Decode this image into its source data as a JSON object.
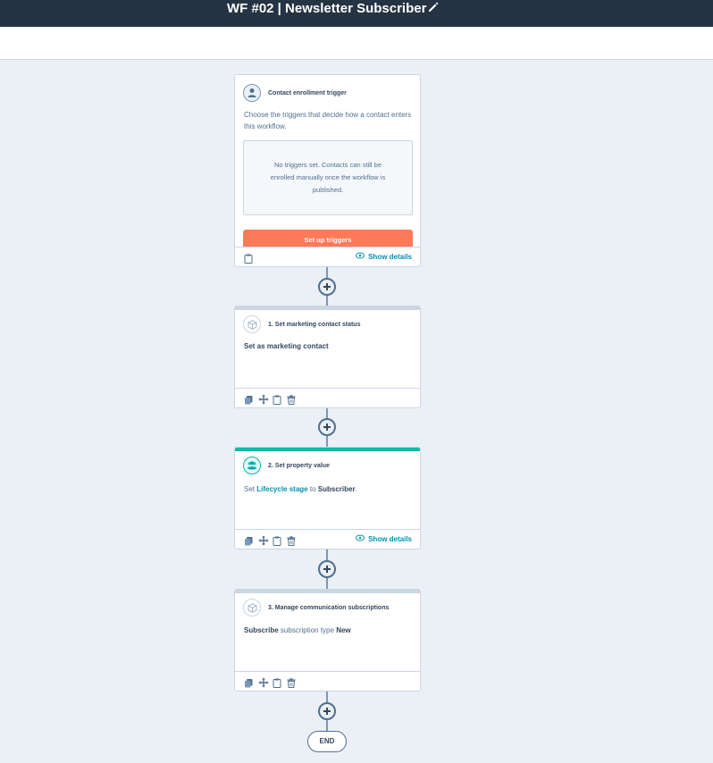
{
  "header": {
    "workflow_title": "WF #02 | Newsletter Subscriber"
  },
  "trigger_card": {
    "title": "Contact enrollment trigger",
    "description": "Choose the triggers that decide how a contact enters this workflow.",
    "empty_state": "No triggers set. Contacts can still be enrolled manually once the workflow is published.",
    "cta_label": "Set up triggers",
    "show_details_label": "Show details"
  },
  "actions": [
    {
      "title": "1. Set marketing contact status",
      "body": "Set as marketing contact",
      "icon": "cube-icon"
    },
    {
      "title": "2. Set property value",
      "body_prefix": "Set",
      "property": "Lifecycle stage",
      "body_mid": "to",
      "value": "Subscriber",
      "body_suffix": ".",
      "show_details_label": "Show details",
      "icon": "people-icon",
      "accent": "#00bda5"
    },
    {
      "title": "3. Manage communication subscriptions",
      "action_word": "Subscribe",
      "body_mid": "subscription type",
      "value": "New",
      "icon": "cube-icon"
    }
  ],
  "end_label": "END",
  "colors": {
    "topbar": "#253342",
    "canvas": "#eaf0f6",
    "cta": "#ff7a59",
    "link": "#0091ae",
    "teal_accent": "#00bda5"
  }
}
